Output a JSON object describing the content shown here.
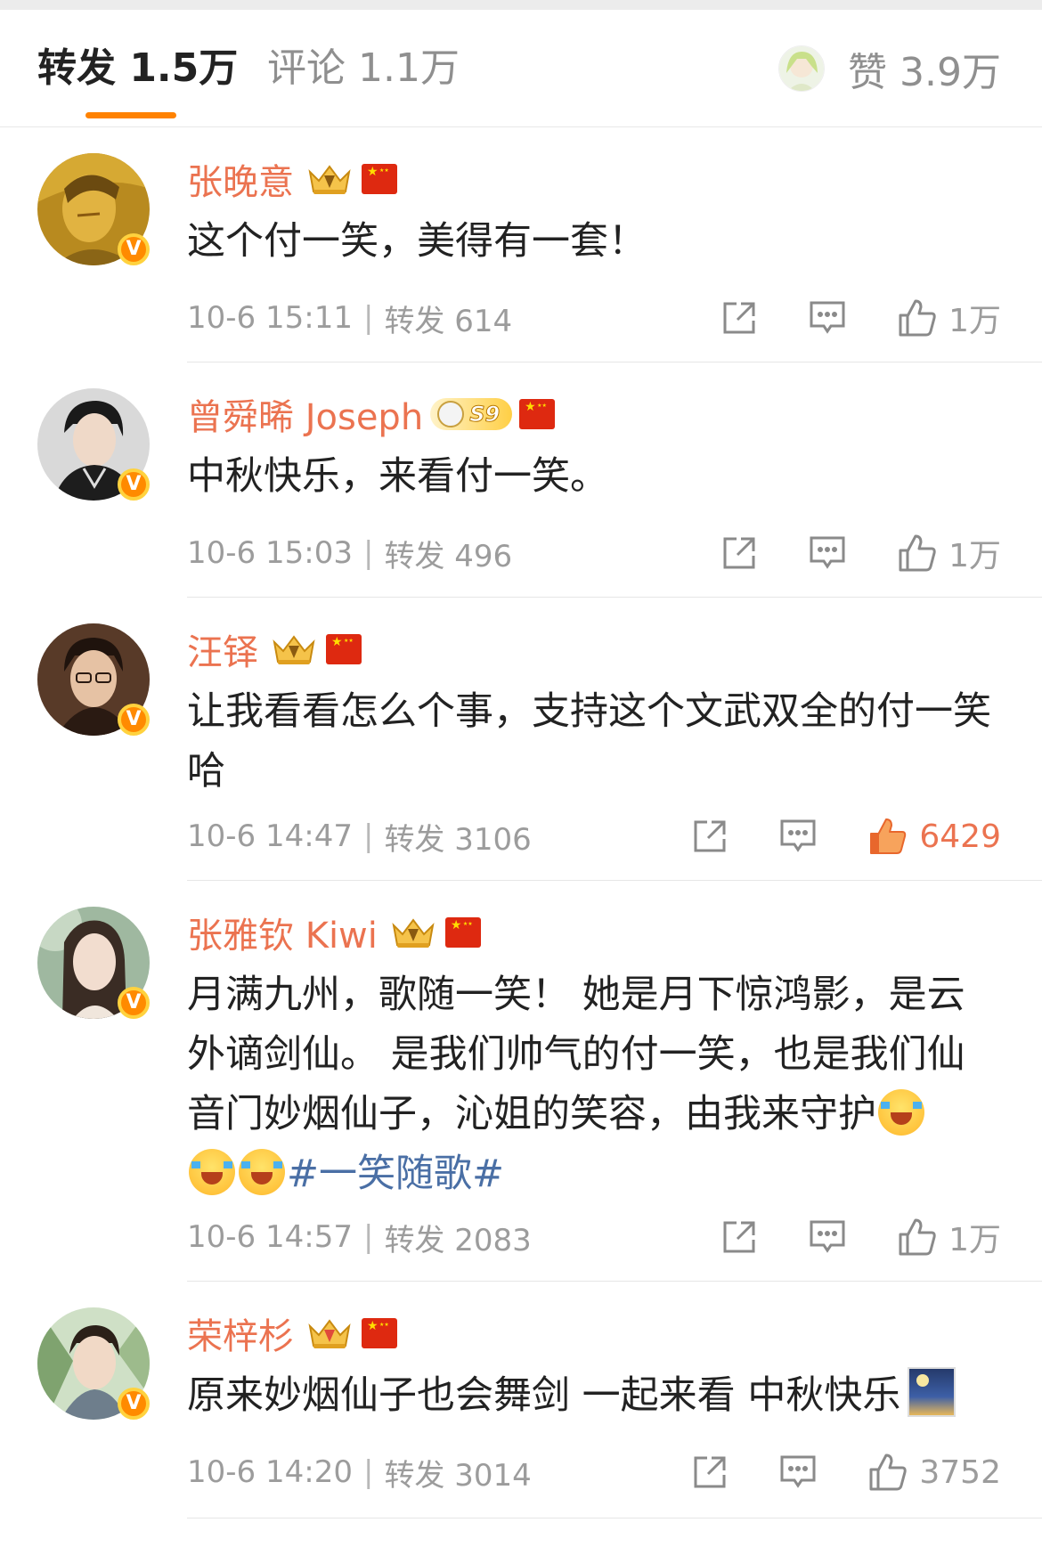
{
  "tabs": {
    "repost": "转发 1.5万",
    "comment": "评论 1.1万",
    "like": "赞 3.9万"
  },
  "colors": {
    "accent": "#ff8200",
    "username": "#eb7350",
    "meta": "#9c9c9c",
    "hashtag": "#4a6fa5"
  },
  "comments": [
    {
      "name": "张晚意",
      "text": "这个付一笑，美得有一套！",
      "time": "10-6 15:11",
      "repost_label": "转发 614",
      "likes": "1万",
      "badge": "crown"
    },
    {
      "name": "曾舜晞 Joseph",
      "text": "中秋快乐，来看付一笑。",
      "time": "10-6 15:03",
      "repost_label": "转发 496",
      "likes": "1万",
      "badge": "S9",
      "badge_text": "S9"
    },
    {
      "name": "汪铎",
      "text": "让我看看怎么个事，支持这个文武双全的付一笑哈",
      "time": "10-6 14:47",
      "repost_label": "转发 3106",
      "likes": "6429",
      "liked": true,
      "badge": "crown"
    },
    {
      "name": "张雅钦 Kiwi",
      "text": "月满九州，歌随一笑！ 她是月下惊鸿影，是云外谪剑仙。 是我们帅气的付一笑，也是我们仙音门妙烟仙子，沁姐的笑容，由我来守护",
      "hashtag": "#一笑随歌#",
      "time": "10-6 14:57",
      "repost_label": "转发 2083",
      "likes": "1万",
      "badge": "crown"
    },
    {
      "name": "荣梓杉",
      "text": "原来妙烟仙子也会舞剑 一起来看 中秋快乐",
      "time": "10-6 14:20",
      "repost_label": "转发 3014",
      "likes": "3752",
      "badge": "crown"
    }
  ],
  "icons": {
    "share": "share-icon",
    "comment": "comment-icon",
    "like": "thumbs-up-icon",
    "verified": "verified-v-icon",
    "flag": "china-flag-icon",
    "crown": "crown-badge-icon"
  },
  "verified_mark": "V"
}
